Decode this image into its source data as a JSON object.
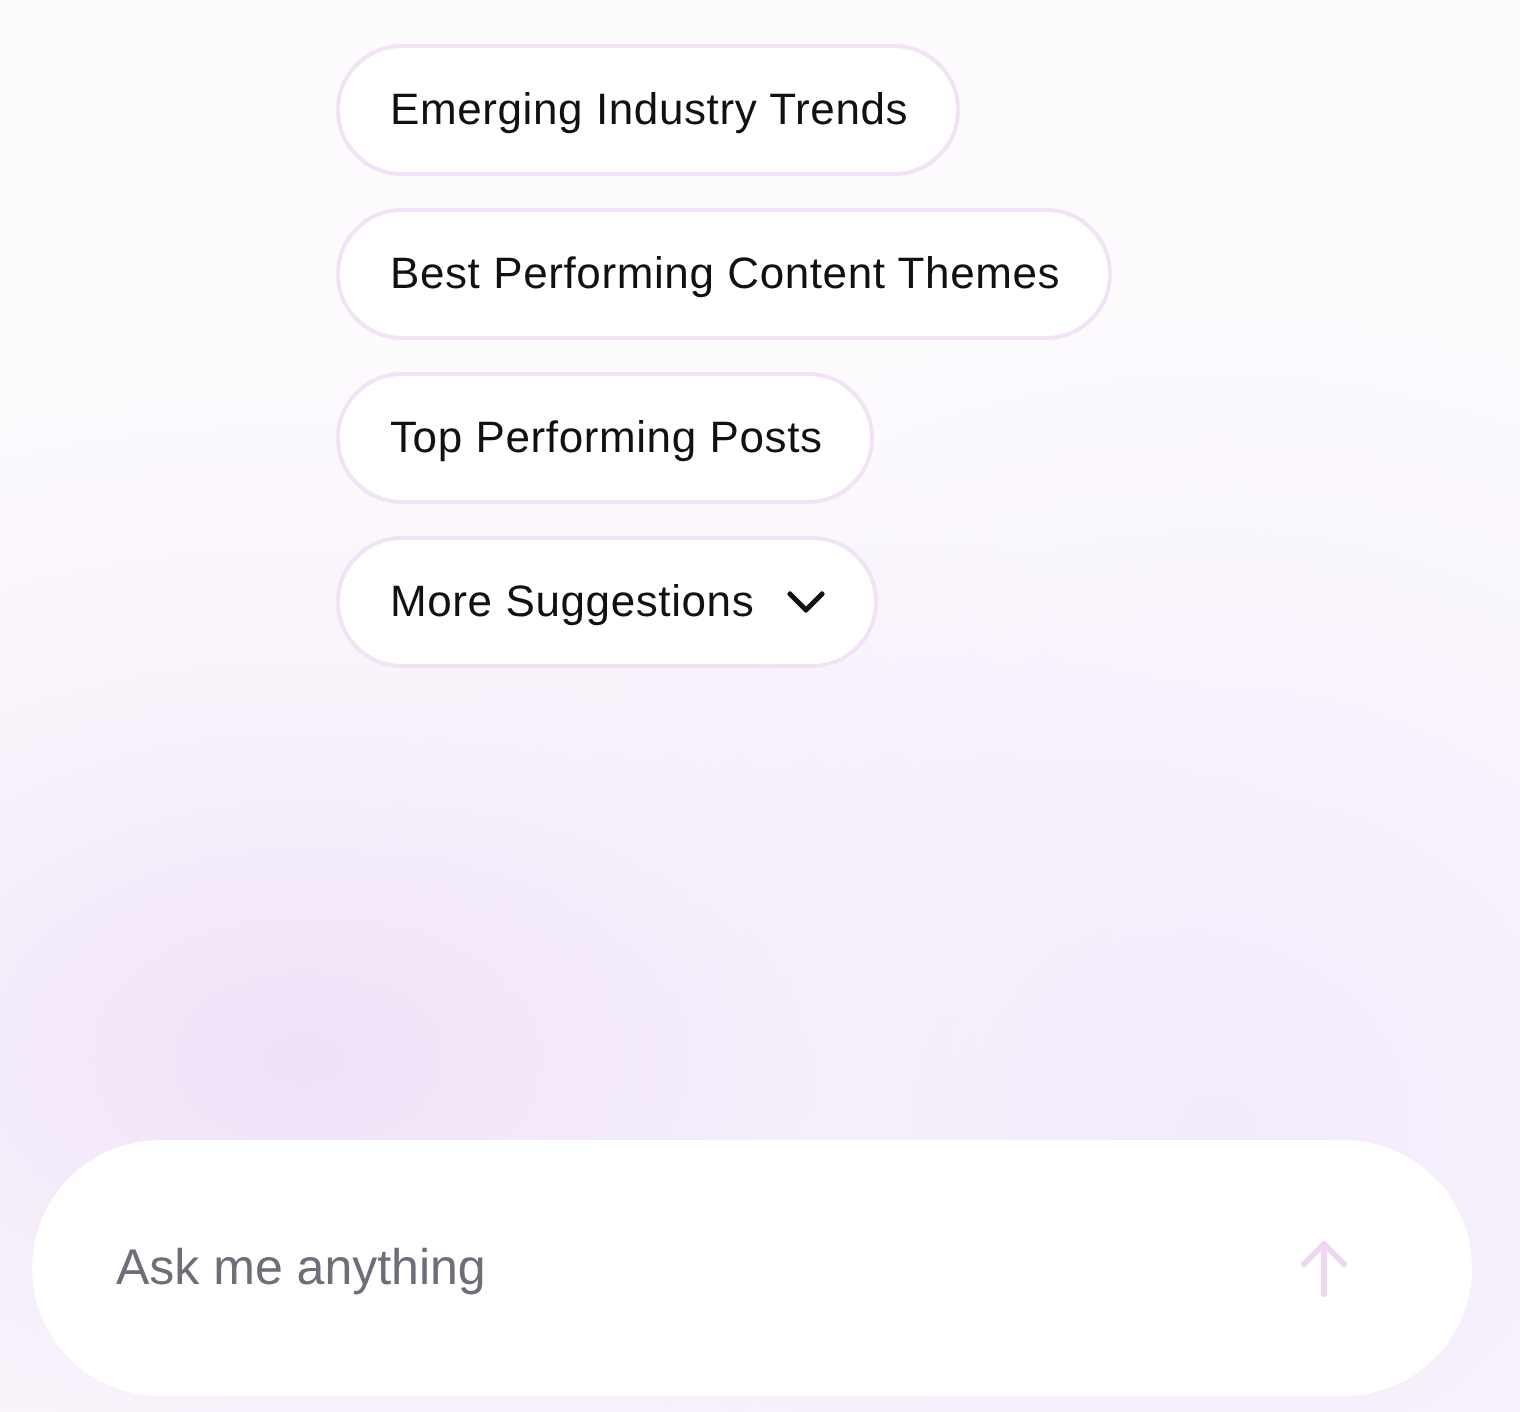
{
  "suggestions": [
    {
      "kind": "prompt",
      "label": "Emerging Industry Trends"
    },
    {
      "kind": "prompt",
      "label": "Best Performing Content Themes"
    },
    {
      "kind": "prompt",
      "label": "Top Performing Posts"
    },
    {
      "kind": "more",
      "label": "More Suggestions"
    }
  ],
  "composer": {
    "placeholder": "Ask me anything",
    "send_disabled": true
  }
}
